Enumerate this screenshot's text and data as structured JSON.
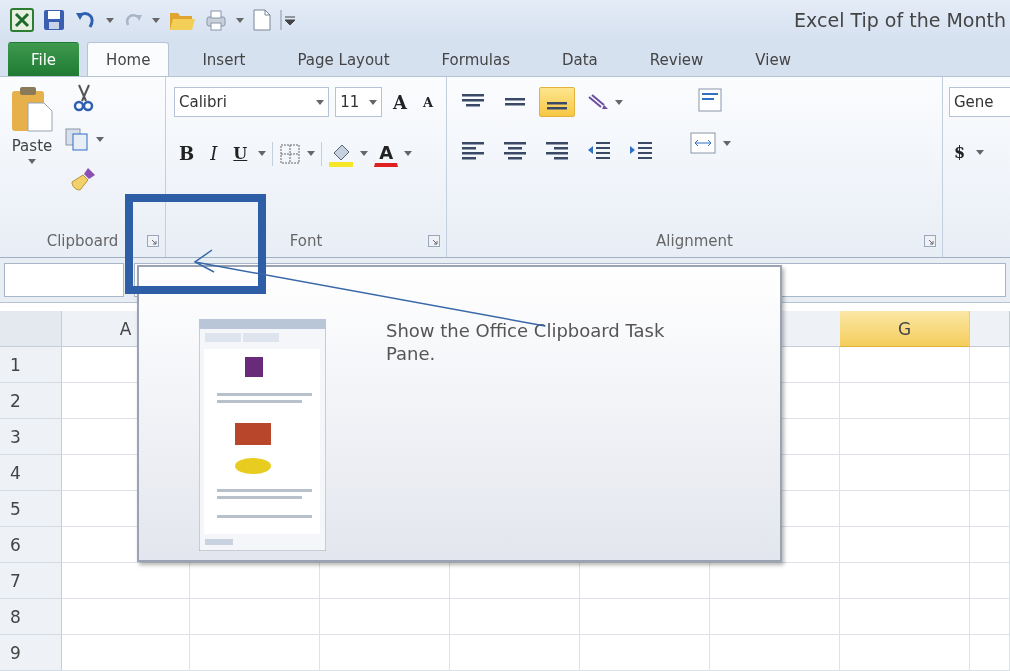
{
  "window": {
    "title": "Excel Tip of the Month"
  },
  "tabs": [
    {
      "label": "File",
      "kind": "file",
      "selected": false
    },
    {
      "label": "Home",
      "kind": "tab",
      "selected": true
    },
    {
      "label": "Insert",
      "kind": "tab",
      "selected": false
    },
    {
      "label": "Page Layout",
      "kind": "tab",
      "selected": false
    },
    {
      "label": "Formulas",
      "kind": "tab",
      "selected": false
    },
    {
      "label": "Data",
      "kind": "tab",
      "selected": false
    },
    {
      "label": "Review",
      "kind": "tab",
      "selected": false
    },
    {
      "label": "View",
      "kind": "tab",
      "selected": false
    }
  ],
  "clipboard": {
    "label": "Clipboard",
    "paste": "Paste"
  },
  "font": {
    "label": "Font",
    "font_name": "Calibri",
    "font_size": "11",
    "grow": "A",
    "shrink": "A",
    "bold": "B",
    "italic": "I",
    "underline": "U",
    "font_color": "A"
  },
  "alignment": {
    "label": "Alignment",
    "buttons": [
      {
        "kind": "top",
        "selected": false
      },
      {
        "kind": "middle",
        "selected": false
      },
      {
        "kind": "bottom",
        "selected": true
      },
      {
        "kind": "orientation",
        "selected": false
      },
      {
        "kind": "left",
        "selected": false
      },
      {
        "kind": "center",
        "selected": false
      },
      {
        "kind": "right",
        "selected": false
      },
      {
        "kind": "outdent",
        "selected": false
      },
      {
        "kind": "indent",
        "selected": false
      }
    ]
  },
  "number": {
    "format": "Gene",
    "currency": "$"
  },
  "sheet": {
    "columns": [
      {
        "label": "A",
        "selected": false
      },
      {
        "label": "G",
        "selected": true
      },
      {
        "selected": false
      }
    ],
    "rows": [
      "1",
      "2",
      "3",
      "4",
      "5",
      "6",
      "7",
      "8",
      "9"
    ]
  },
  "tooltip": {
    "description": "Show the Office Clipboard Task Pane."
  }
}
